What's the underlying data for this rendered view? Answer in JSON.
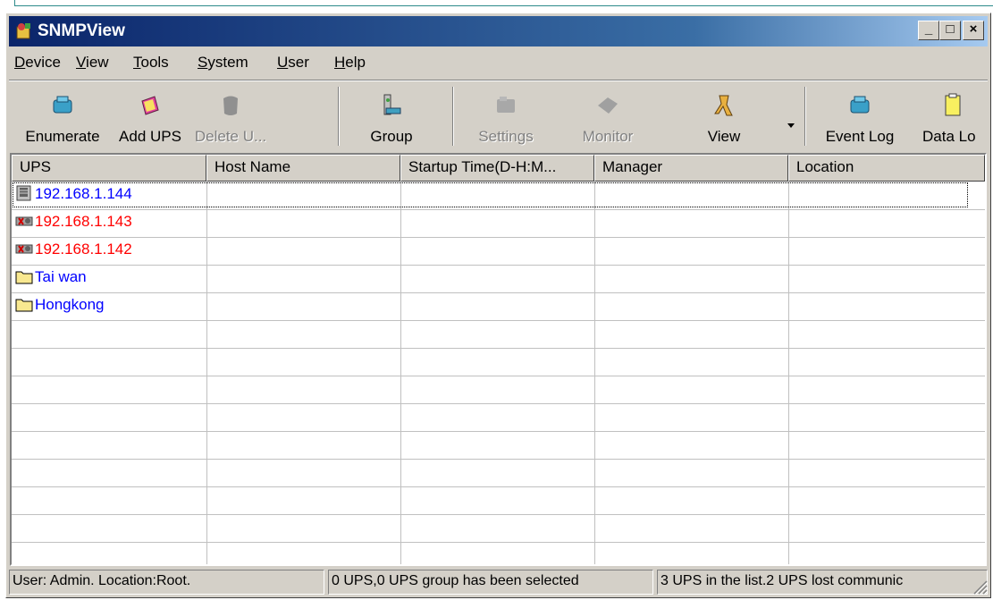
{
  "window": {
    "title": "SNMPView",
    "minimize": "_",
    "maximize": "□",
    "close": "×"
  },
  "menu": [
    {
      "label": "Device",
      "u": "D",
      "rest": "evice"
    },
    {
      "label": "View",
      "u": "V",
      "rest": "iew"
    },
    {
      "label": "Tools",
      "u": "T",
      "rest": "ools"
    },
    {
      "label": "System",
      "u": "S",
      "rest": "ystem"
    },
    {
      "label": "User",
      "u": "U",
      "rest": "ser"
    },
    {
      "label": "Help",
      "u": "H",
      "rest": "elp"
    }
  ],
  "toolbar": [
    {
      "label": "Enumerate",
      "icon": "enumerate-icon",
      "enabled": true
    },
    {
      "label": "Add UPS",
      "icon": "add-ups-icon",
      "enabled": true
    },
    {
      "label": "Delete U...",
      "icon": "delete-ups-icon",
      "enabled": false
    },
    {
      "label": "Group",
      "icon": "group-icon",
      "enabled": true
    },
    {
      "label": "Settings",
      "icon": "settings-icon",
      "enabled": false
    },
    {
      "label": "Monitor",
      "icon": "monitor-icon",
      "enabled": false
    },
    {
      "label": "View",
      "icon": "view-icon",
      "enabled": true
    },
    {
      "label": "Event Log",
      "icon": "event-log-icon",
      "enabled": true
    },
    {
      "label": "Data Lo",
      "icon": "data-log-icon",
      "enabled": true
    }
  ],
  "columns": [
    "UPS",
    "Host Name",
    "Startup Time(D-H:M...",
    "Manager",
    "Location"
  ],
  "rows": [
    {
      "ups": "192.168.1.144",
      "icon": "ups-online-icon",
      "color": "#0000ff"
    },
    {
      "ups": "192.168.1.143",
      "icon": "ups-lost-icon",
      "color": "#ff0000"
    },
    {
      "ups": "192.168.1.142",
      "icon": "ups-lost-icon",
      "color": "#ff0000"
    },
    {
      "ups": "Tai wan",
      "icon": "folder-icon",
      "color": "#0000ff"
    },
    {
      "ups": "Hongkong",
      "icon": "folder-icon",
      "color": "#0000ff"
    }
  ],
  "status": {
    "user": "User: Admin.  Location:Root.",
    "selection": "0 UPS,0 UPS group has been selected",
    "summary": "3 UPS in the list.2 UPS  lost communic"
  }
}
